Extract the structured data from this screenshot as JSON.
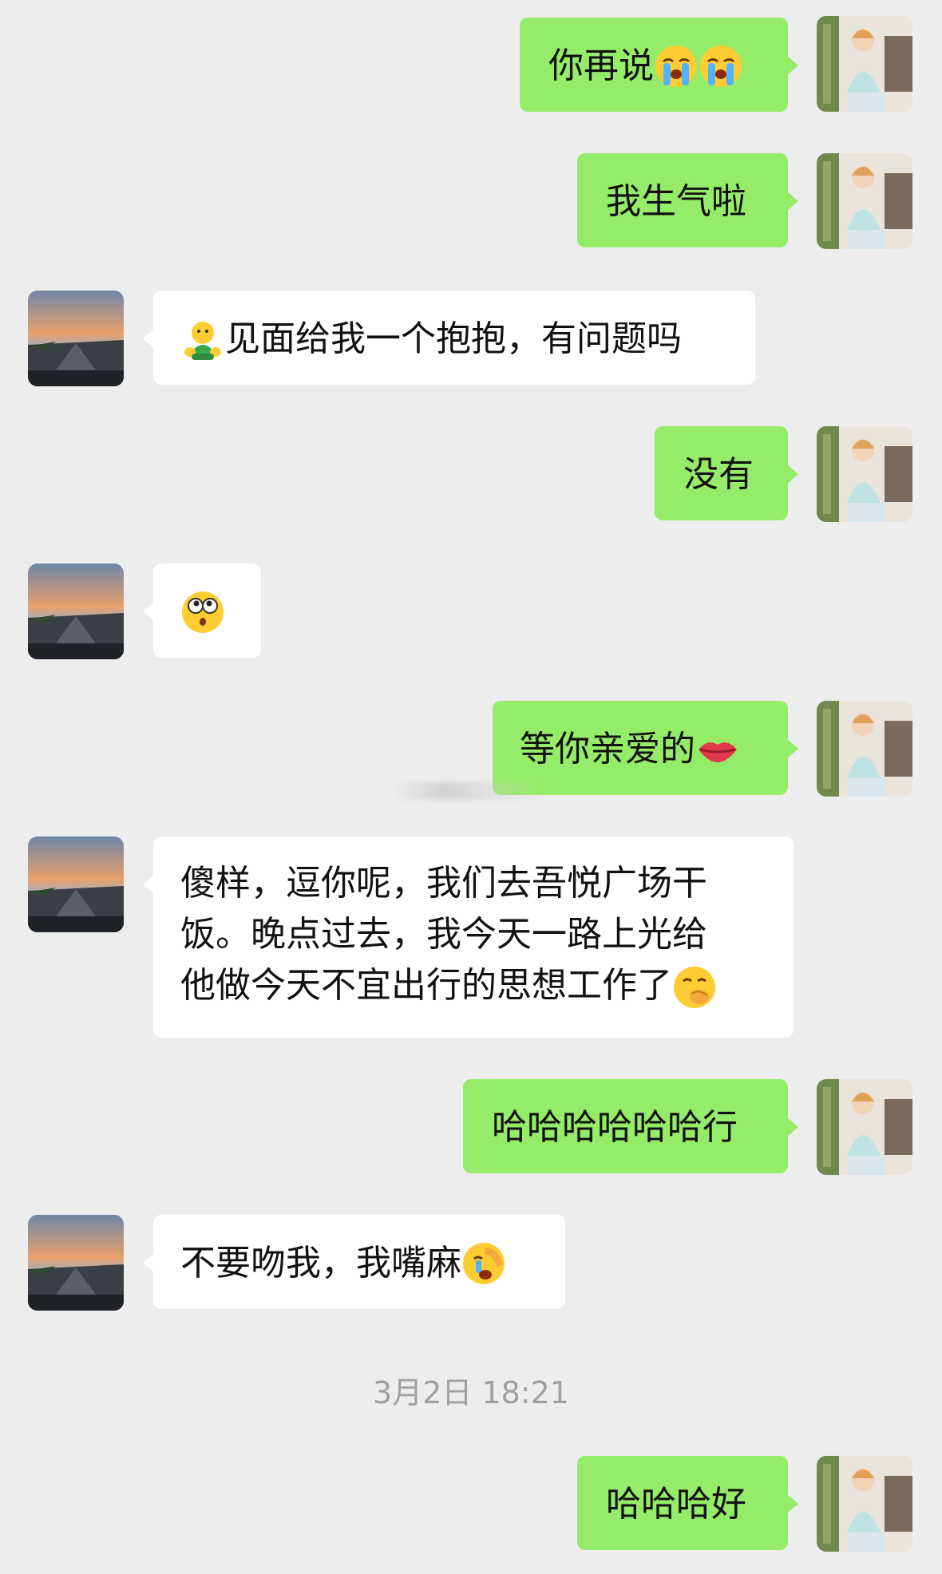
{
  "messages": [
    {
      "from": "me",
      "text": "你再说",
      "emoji": [
        "loudly-crying-emoji",
        "loudly-crying-emoji"
      ]
    },
    {
      "from": "me",
      "text": "我生气啦"
    },
    {
      "from": "other",
      "emoji_before": "hugging-figure-emoji",
      "text": "见面给我一个抱抱，有问题吗"
    },
    {
      "from": "me",
      "text": "没有"
    },
    {
      "from": "other",
      "emoji": [
        "surprised-eyes-emoji"
      ]
    },
    {
      "from": "me",
      "text": "等你亲爱的",
      "emoji": [
        "lips-emoji"
      ]
    },
    {
      "from": "other",
      "lines": [
        "傻样，逗你呢，我们去吾悦广场干",
        "饭。晚点过去，我今天一路上光给",
        "他做今天不宜出行的思想工作了"
      ],
      "emoji": [
        "thinking-hand-emoji"
      ]
    },
    {
      "from": "me",
      "text": "哈哈哈哈哈哈行"
    },
    {
      "from": "other",
      "text": "不要吻我，我嘴麻",
      "emoji": [
        "facepalm-emoji"
      ]
    },
    {
      "from": "me",
      "text": "哈哈哈好"
    }
  ],
  "timestamp": "3月2日 18:21",
  "colors": {
    "background": "#ededed",
    "my_bubble": "#95ec69",
    "other_bubble": "#ffffff",
    "timestamp_text": "#a0a0a0"
  },
  "icons": {
    "my_avatar": "woman-photo-avatar",
    "other_avatar": "sunset-road-avatar"
  }
}
